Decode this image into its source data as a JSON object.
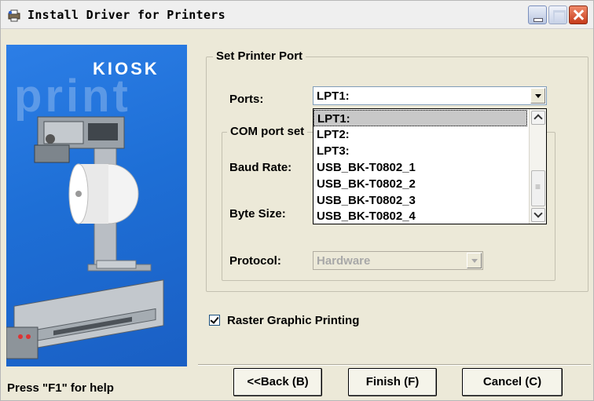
{
  "window": {
    "title": "Install Driver for Printers"
  },
  "banner": {
    "title": "KIOSK",
    "faded_text": "print"
  },
  "port_group": {
    "label": "Set Printer Port",
    "ports_label": "Ports:",
    "ports_value": "LPT1:",
    "ports_options": [
      "LPT1:",
      "LPT2:",
      "LPT3:",
      "USB_BK-T0802_1",
      "USB_BK-T0802_2",
      "USB_BK-T0802_3",
      "USB_BK-T0802_4"
    ],
    "selected_index": 0
  },
  "com_group": {
    "label": "COM port set",
    "baud_rate_label": "Baud Rate:",
    "byte_size_label": "Byte Size:",
    "protocol_label": "Protocol:",
    "protocol_value": "Hardware"
  },
  "raster": {
    "label": "Raster Graphic Printing",
    "checked": true
  },
  "buttons": {
    "back": "<<Back (B)",
    "finish": "Finish (F)",
    "cancel": "Cancel (C)"
  },
  "status": {
    "help": "Press \"F1\" for help"
  }
}
